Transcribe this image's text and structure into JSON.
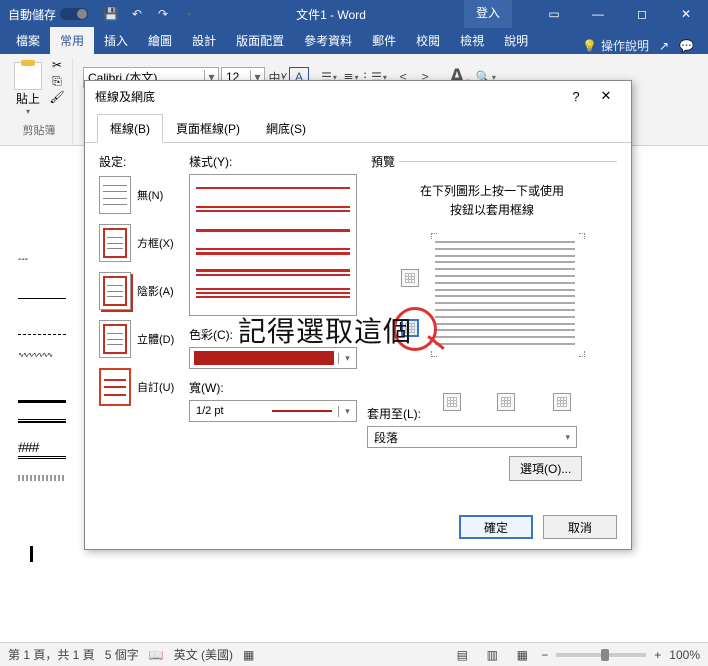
{
  "titlebar": {
    "autosave": "自動儲存",
    "title": "文件1 - Word",
    "login": "登入"
  },
  "ribbon_tabs": [
    "檔案",
    "常用",
    "插入",
    "繪圖",
    "設計",
    "版面配置",
    "參考資料",
    "郵件",
    "校閱",
    "檢視",
    "說明"
  ],
  "ribbon_tabs_active_index": 1,
  "tell_me": "操作說明",
  "font": {
    "name": "Calibri (本文)",
    "size": "12"
  },
  "clipboard": {
    "paste": "貼上",
    "group": "剪貼簿"
  },
  "dialog": {
    "title": "框線及網底",
    "tabs": [
      "框線(B)",
      "頁面框線(P)",
      "網底(S)"
    ],
    "active_tab": 0,
    "setting_label": "設定:",
    "settings": [
      {
        "label": "無(N)"
      },
      {
        "label": "方框(X)"
      },
      {
        "label": "陰影(A)"
      },
      {
        "label": "立體(D)"
      },
      {
        "label": "自訂(U)"
      }
    ],
    "selected_setting": 4,
    "style_label": "樣式(Y):",
    "color_label": "色彩(C):",
    "color_value": "#b02018",
    "width_label": "寬(W):",
    "width_value": "1/2 pt",
    "preview_label": "預覽",
    "preview_hint1": "在下列圖形上按一下或使用",
    "preview_hint2": "按鈕以套用框線",
    "apply_label": "套用至(L):",
    "apply_value": "段落",
    "options_btn": "選項(O)...",
    "ok": "確定",
    "cancel": "取消"
  },
  "annotation": "記得選取這個",
  "status": {
    "page": "第 1 頁，共 1 頁",
    "words": "5 個字",
    "lang": "英文 (美國)",
    "zoom": "100%"
  }
}
